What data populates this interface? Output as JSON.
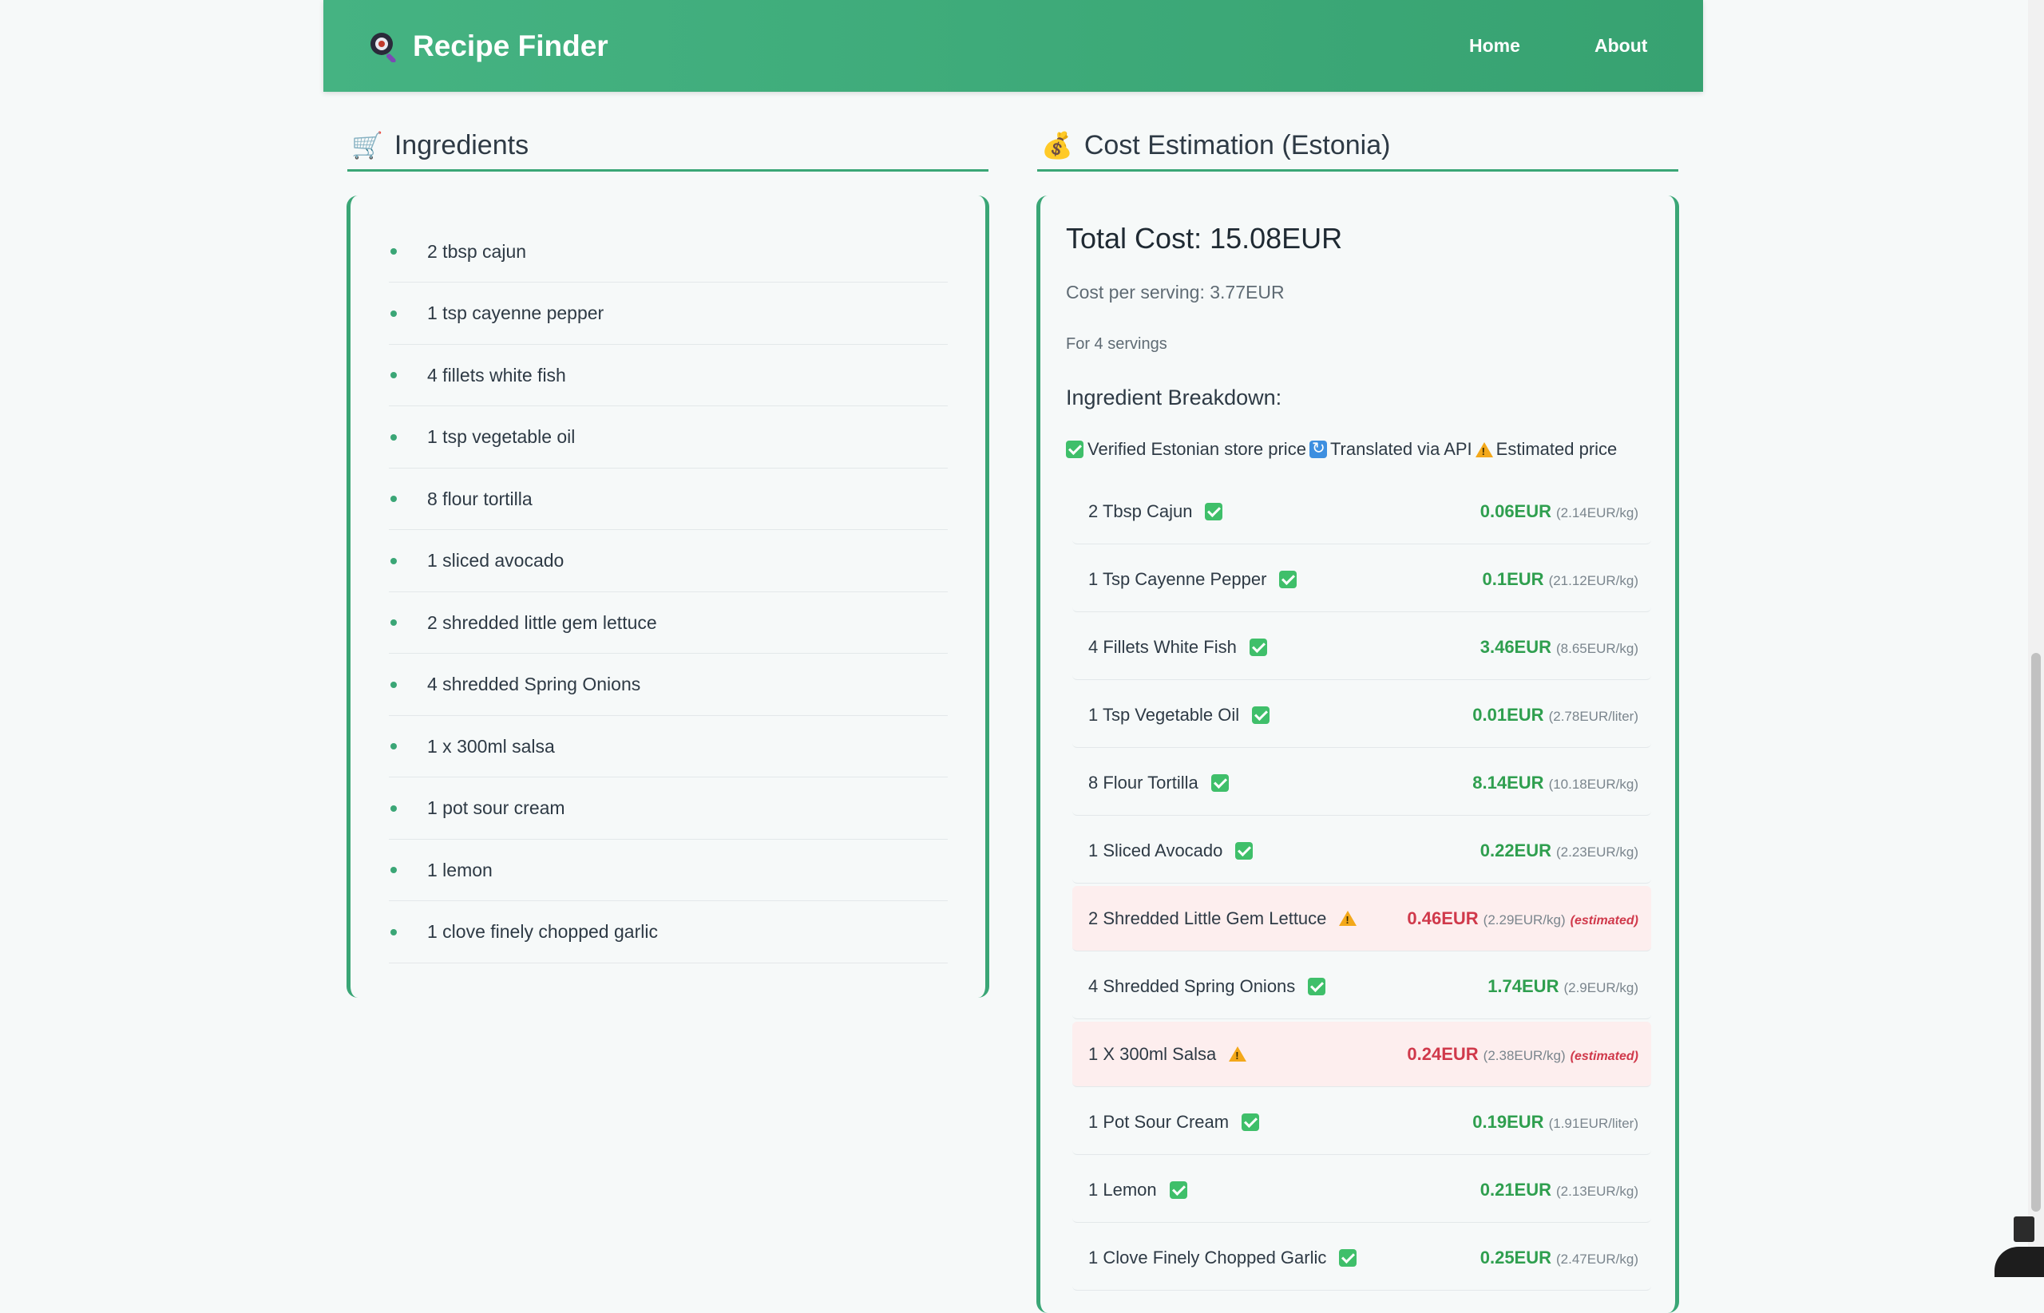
{
  "header": {
    "title": "Recipe Finder",
    "nav": [
      "Home",
      "About"
    ]
  },
  "ingredients": {
    "title": "Ingredients",
    "icon": "shopping-cart-icon",
    "items": [
      "2 tbsp cajun",
      "1 tsp cayenne pepper",
      "4 fillets white fish",
      "1 tsp vegetable oil",
      "8 flour tortilla",
      "1 sliced avocado",
      "2 shredded little gem lettuce",
      "4 shredded Spring Onions",
      "1 x 300ml salsa",
      "1 pot sour cream",
      "1 lemon",
      "1 clove finely chopped garlic"
    ]
  },
  "cost": {
    "title": "Cost Estimation (Estonia)",
    "icon": "money-bag-icon",
    "total": "Total Cost: 15.08EUR",
    "per_serving": "Cost per serving: 3.77EUR",
    "servings": "For 4 servings",
    "breakdown_title": "Ingredient Breakdown:",
    "legend": {
      "verified": "Verified Estonian store price",
      "translated": "Translated via API",
      "estimated": "Estimated price"
    },
    "rows": [
      {
        "name": "2 Tbsp Cajun",
        "status": "verified",
        "price": "0.06EUR",
        "unit": "(2.14EUR/kg)"
      },
      {
        "name": "1 Tsp Cayenne Pepper",
        "status": "verified",
        "price": "0.1EUR",
        "unit": "(21.12EUR/kg)"
      },
      {
        "name": "4 Fillets White Fish",
        "status": "verified",
        "price": "3.46EUR",
        "unit": "(8.65EUR/kg)"
      },
      {
        "name": "1 Tsp Vegetable Oil",
        "status": "verified",
        "price": "0.01EUR",
        "unit": "(2.78EUR/liter)"
      },
      {
        "name": "8 Flour Tortilla",
        "status": "verified",
        "price": "8.14EUR",
        "unit": "(10.18EUR/kg)"
      },
      {
        "name": "1 Sliced Avocado",
        "status": "verified",
        "price": "0.22EUR",
        "unit": "(2.23EUR/kg)"
      },
      {
        "name": "2 Shredded Little Gem Lettuce",
        "status": "estimated",
        "price": "0.46EUR",
        "unit": "(2.29EUR/kg)",
        "tag": "(estimated)"
      },
      {
        "name": "4 Shredded Spring Onions",
        "status": "verified",
        "price": "1.74EUR",
        "unit": "(2.9EUR/kg)"
      },
      {
        "name": "1 X 300ml Salsa",
        "status": "estimated",
        "price": "0.24EUR",
        "unit": "(2.38EUR/kg)",
        "tag": "(estimated)"
      },
      {
        "name": "1 Pot Sour Cream",
        "status": "verified",
        "price": "0.19EUR",
        "unit": "(1.91EUR/liter)"
      },
      {
        "name": "1 Lemon",
        "status": "verified",
        "price": "0.21EUR",
        "unit": "(2.13EUR/kg)"
      },
      {
        "name": "1 Clove Finely Chopped Garlic",
        "status": "verified",
        "price": "0.25EUR",
        "unit": "(2.47EUR/kg)"
      }
    ]
  },
  "colors": {
    "accent": "#3aa676",
    "verified": "#2f9f4f",
    "estimated": "#d0394b"
  }
}
